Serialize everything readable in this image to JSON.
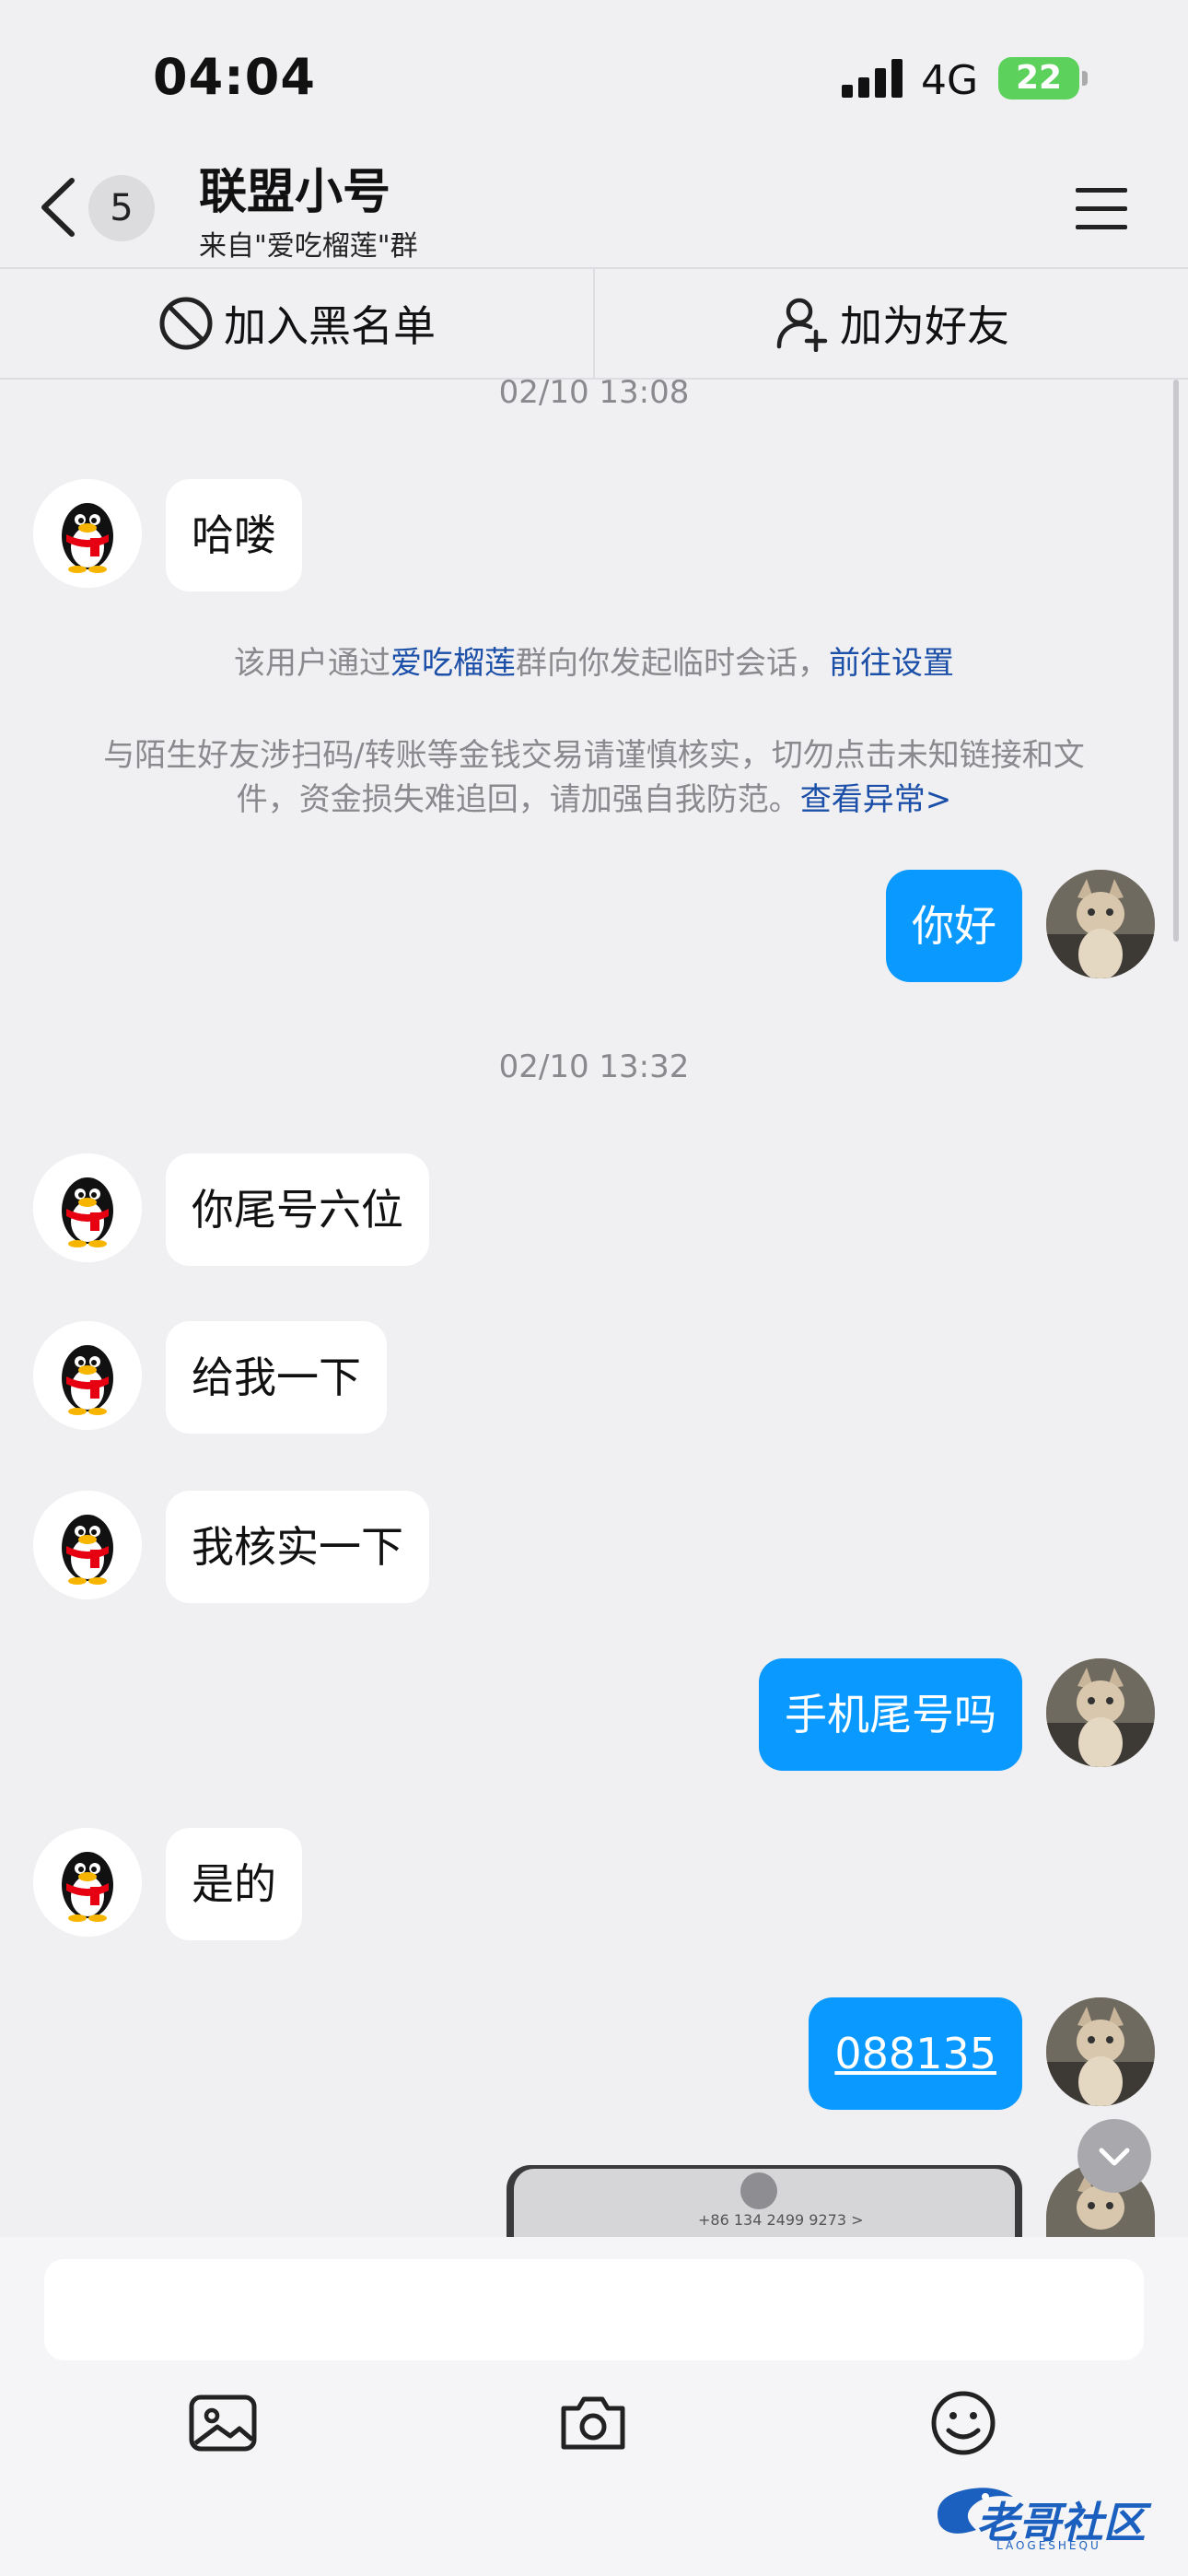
{
  "status_bar": {
    "time": "04:04",
    "network": "4G",
    "battery": "22"
  },
  "header": {
    "back_badge": "5",
    "title": "联盟小号",
    "subtitle": "来自\"爱吃榴莲\"群"
  },
  "actions": {
    "block_label": "加入黑名单",
    "add_friend_label": "加为好友"
  },
  "chat": {
    "timestamp_1": "02/10 13:08",
    "msg_hello": "哈喽",
    "notice_1_prefix": "该用户通过",
    "notice_1_group": "爱吃榴莲",
    "notice_1_middle": "群向你发起临时会话，",
    "notice_1_link": "前往设置",
    "notice_2_line1": "与陌生好友涉扫码/转账等金钱交易请谨慎核实，切勿点击未知链接和文",
    "notice_2_line2": "件，资金损失难追回，请加强自我防范。",
    "notice_2_link": "查看异常>",
    "msg_nihao": "你好",
    "timestamp_2": "02/10 13:32",
    "msg_1": "你尾号六位",
    "msg_2": "给我一下",
    "msg_3": "我核实一下",
    "msg_4": "手机尾号吗",
    "msg_5": "是的",
    "msg_6": "088135",
    "image_caption": "+86 134 2499 9273 >"
  },
  "watermark": {
    "text": "老哥社区",
    "sub": "LAOGESHEQU"
  },
  "icons": [
    "back-icon",
    "menu-icon",
    "block-icon",
    "add-user-icon",
    "image-icon",
    "camera-icon",
    "emoji-icon",
    "chevron-down-icon"
  ]
}
